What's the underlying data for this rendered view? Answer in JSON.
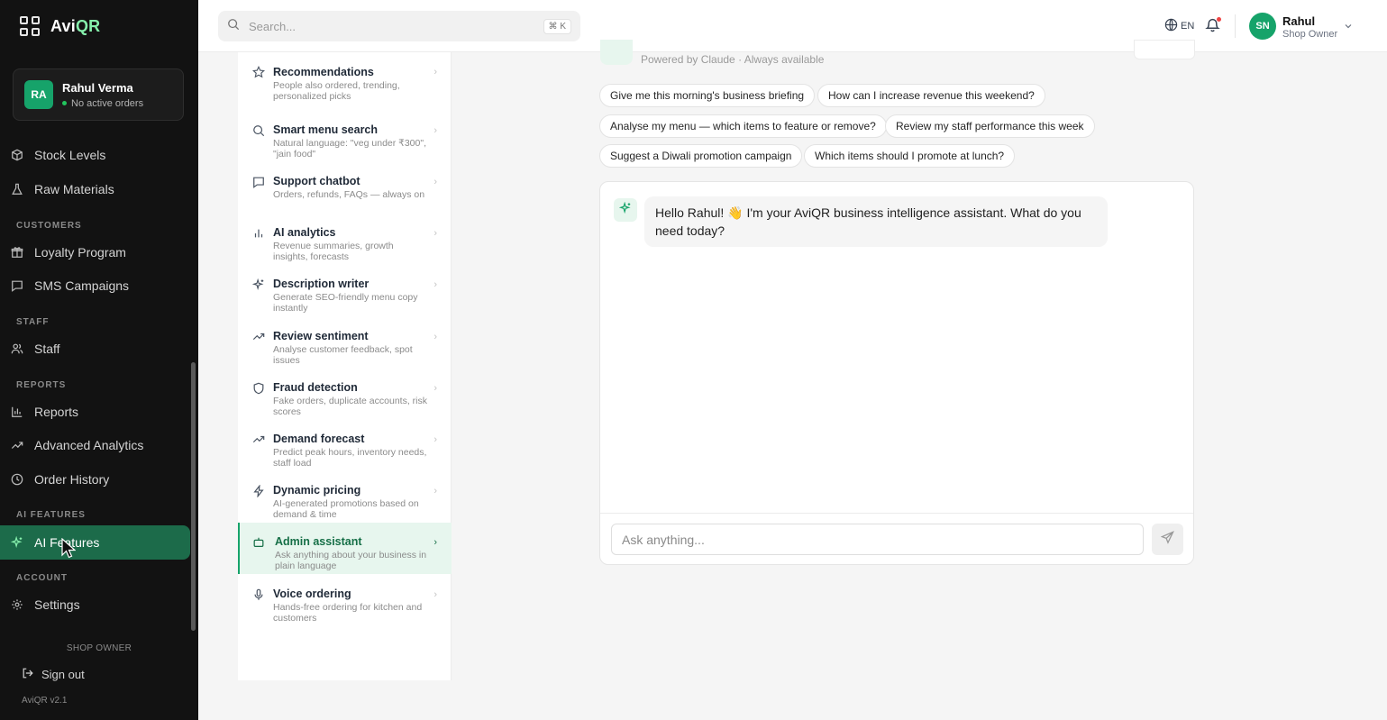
{
  "app": {
    "brand_prefix": "Avi",
    "brand_suffix": "QR",
    "version": "AviQR v2.1"
  },
  "sidebar": {
    "user": {
      "initials": "RA",
      "name": "Rahul Verma",
      "status": "No active orders"
    },
    "items": [
      {
        "label": "Stock Levels",
        "icon": "box-icon"
      },
      {
        "label": "Raw Materials",
        "icon": "flask-icon"
      },
      {
        "label": "Loyalty Program",
        "icon": "gift-icon"
      },
      {
        "label": "SMS Campaigns",
        "icon": "message-icon"
      },
      {
        "label": "Staff",
        "icon": "users-icon"
      },
      {
        "label": "Reports",
        "icon": "bar-chart-icon"
      },
      {
        "label": "Advanced Analytics",
        "icon": "trending-up-icon"
      },
      {
        "label": "Order History",
        "icon": "clock-icon"
      },
      {
        "label": "AI Features",
        "icon": "sparkles-icon",
        "active": true
      },
      {
        "label": "Settings",
        "icon": "gear-icon"
      }
    ],
    "sections": {
      "customers": "CUSTOMERS",
      "staff": "STAFF",
      "reports": "REPORTS",
      "ai_features": "AI FEATURES",
      "account": "ACCOUNT"
    },
    "footer": {
      "role": "SHOP OWNER",
      "sign_out": "Sign out"
    }
  },
  "header": {
    "search": {
      "placeholder": "Search...",
      "shortcut": "⌘ K"
    },
    "language": "EN",
    "user": {
      "initials": "SN",
      "name": "Rahul",
      "role": "Shop Owner"
    }
  },
  "features": [
    {
      "title": "Recommendations",
      "desc": "People also ordered, trending, personalized picks",
      "icon": "star-icon"
    },
    {
      "title": "Smart menu search",
      "desc": "Natural language: \"veg under ₹300\", \"jain food\"",
      "icon": "search-icon"
    },
    {
      "title": "Support chatbot",
      "desc": "Orders, refunds, FAQs — always on",
      "icon": "chat-icon"
    },
    {
      "title": "AI analytics",
      "desc": "Revenue summaries, growth insights, forecasts",
      "icon": "bar-chart-icon"
    },
    {
      "title": "Description writer",
      "desc": "Generate SEO-friendly menu copy instantly",
      "icon": "sparkles-icon"
    },
    {
      "title": "Review sentiment",
      "desc": "Analyse customer feedback, spot issues",
      "icon": "trending-up-icon"
    },
    {
      "title": "Fraud detection",
      "desc": "Fake orders, duplicate accounts, risk scores",
      "icon": "shield-icon"
    },
    {
      "title": "Demand forecast",
      "desc": "Predict peak hours, inventory needs, staff load",
      "icon": "trending-up-icon"
    },
    {
      "title": "Dynamic pricing",
      "desc": "AI-generated promotions based on demand & time",
      "icon": "lightning-icon"
    },
    {
      "title": "Admin assistant",
      "desc": "Ask anything about your business in plain language",
      "icon": "bot-icon",
      "active": true
    },
    {
      "title": "Voice ordering",
      "desc": "Hands-free ordering for kitchen and customers",
      "icon": "mic-icon"
    }
  ],
  "assistant": {
    "powered_by": "Powered by Claude · Always available",
    "chips": [
      "Give me this morning's business briefing",
      "How can I increase revenue this weekend?",
      "Analyse my menu — which items to feature or remove?",
      "Review my staff performance this week",
      "Suggest a Diwali promotion campaign",
      "Which items should I promote at lunch?"
    ],
    "greeting": "Hello Rahul! 👋 I'm your AviQR business intelligence assistant. What do you need today?",
    "input_placeholder": "Ask anything..."
  }
}
